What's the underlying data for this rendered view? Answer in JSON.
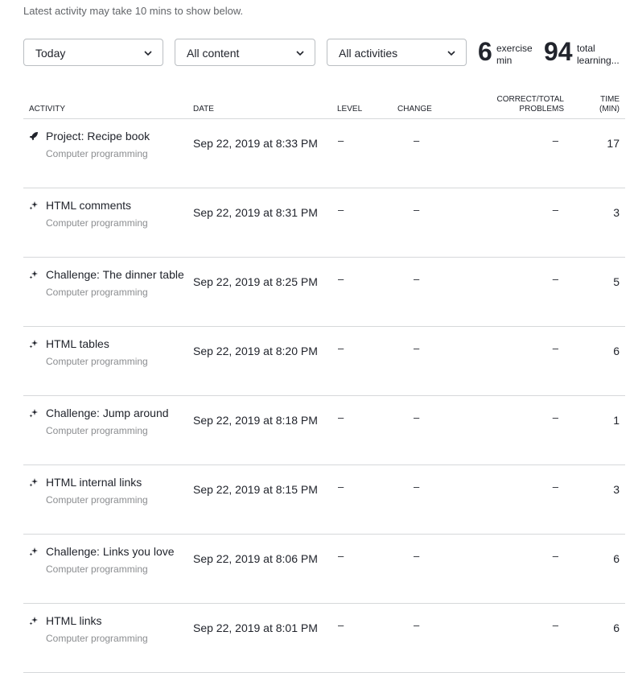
{
  "notice": "Latest activity may take 10 mins to show below.",
  "filters": {
    "date": "Today",
    "content": "All content",
    "activities": "All activities"
  },
  "stats": {
    "exercise": {
      "value": "6",
      "line1": "exercise",
      "line2": "min"
    },
    "total": {
      "value": "94",
      "line1": "total",
      "line2": "learning..."
    }
  },
  "columns": {
    "activity": "ACTIVITY",
    "date": "DATE",
    "level": "LEVEL",
    "change": "CHANGE",
    "correct_line1": "CORRECT/TOTAL",
    "correct_line2": "PROBLEMS",
    "time_line1": "TIME",
    "time_line2": "(MIN)"
  },
  "rows": [
    {
      "icon": "rocket-icon",
      "title": "Project: Recipe book",
      "subject": "Computer programming",
      "date": "Sep 22, 2019 at 8:33 PM",
      "level": "–",
      "change": "–",
      "correct": "–",
      "time": "17"
    },
    {
      "icon": "sparkle-icon",
      "title": "HTML comments",
      "subject": "Computer programming",
      "date": "Sep 22, 2019 at 8:31 PM",
      "level": "–",
      "change": "–",
      "correct": "–",
      "time": "3"
    },
    {
      "icon": "sparkle-icon",
      "title": "Challenge: The dinner table",
      "subject": "Computer programming",
      "date": "Sep 22, 2019 at 8:25 PM",
      "level": "–",
      "change": "–",
      "correct": "–",
      "time": "5"
    },
    {
      "icon": "sparkle-icon",
      "title": "HTML tables",
      "subject": "Computer programming",
      "date": "Sep 22, 2019 at 8:20 PM",
      "level": "–",
      "change": "–",
      "correct": "–",
      "time": "6"
    },
    {
      "icon": "sparkle-icon",
      "title": "Challenge: Jump around",
      "subject": "Computer programming",
      "date": "Sep 22, 2019 at 8:18 PM",
      "level": "–",
      "change": "–",
      "correct": "–",
      "time": "1"
    },
    {
      "icon": "sparkle-icon",
      "title": "HTML internal links",
      "subject": "Computer programming",
      "date": "Sep 22, 2019 at 8:15 PM",
      "level": "–",
      "change": "–",
      "correct": "–",
      "time": "3"
    },
    {
      "icon": "sparkle-icon",
      "title": "Challenge: Links you love",
      "subject": "Computer programming",
      "date": "Sep 22, 2019 at 8:06 PM",
      "level": "–",
      "change": "–",
      "correct": "–",
      "time": "6"
    },
    {
      "icon": "sparkle-icon",
      "title": "HTML links",
      "subject": "Computer programming",
      "date": "Sep 22, 2019 at 8:01 PM",
      "level": "–",
      "change": "–",
      "correct": "–",
      "time": "6"
    }
  ]
}
